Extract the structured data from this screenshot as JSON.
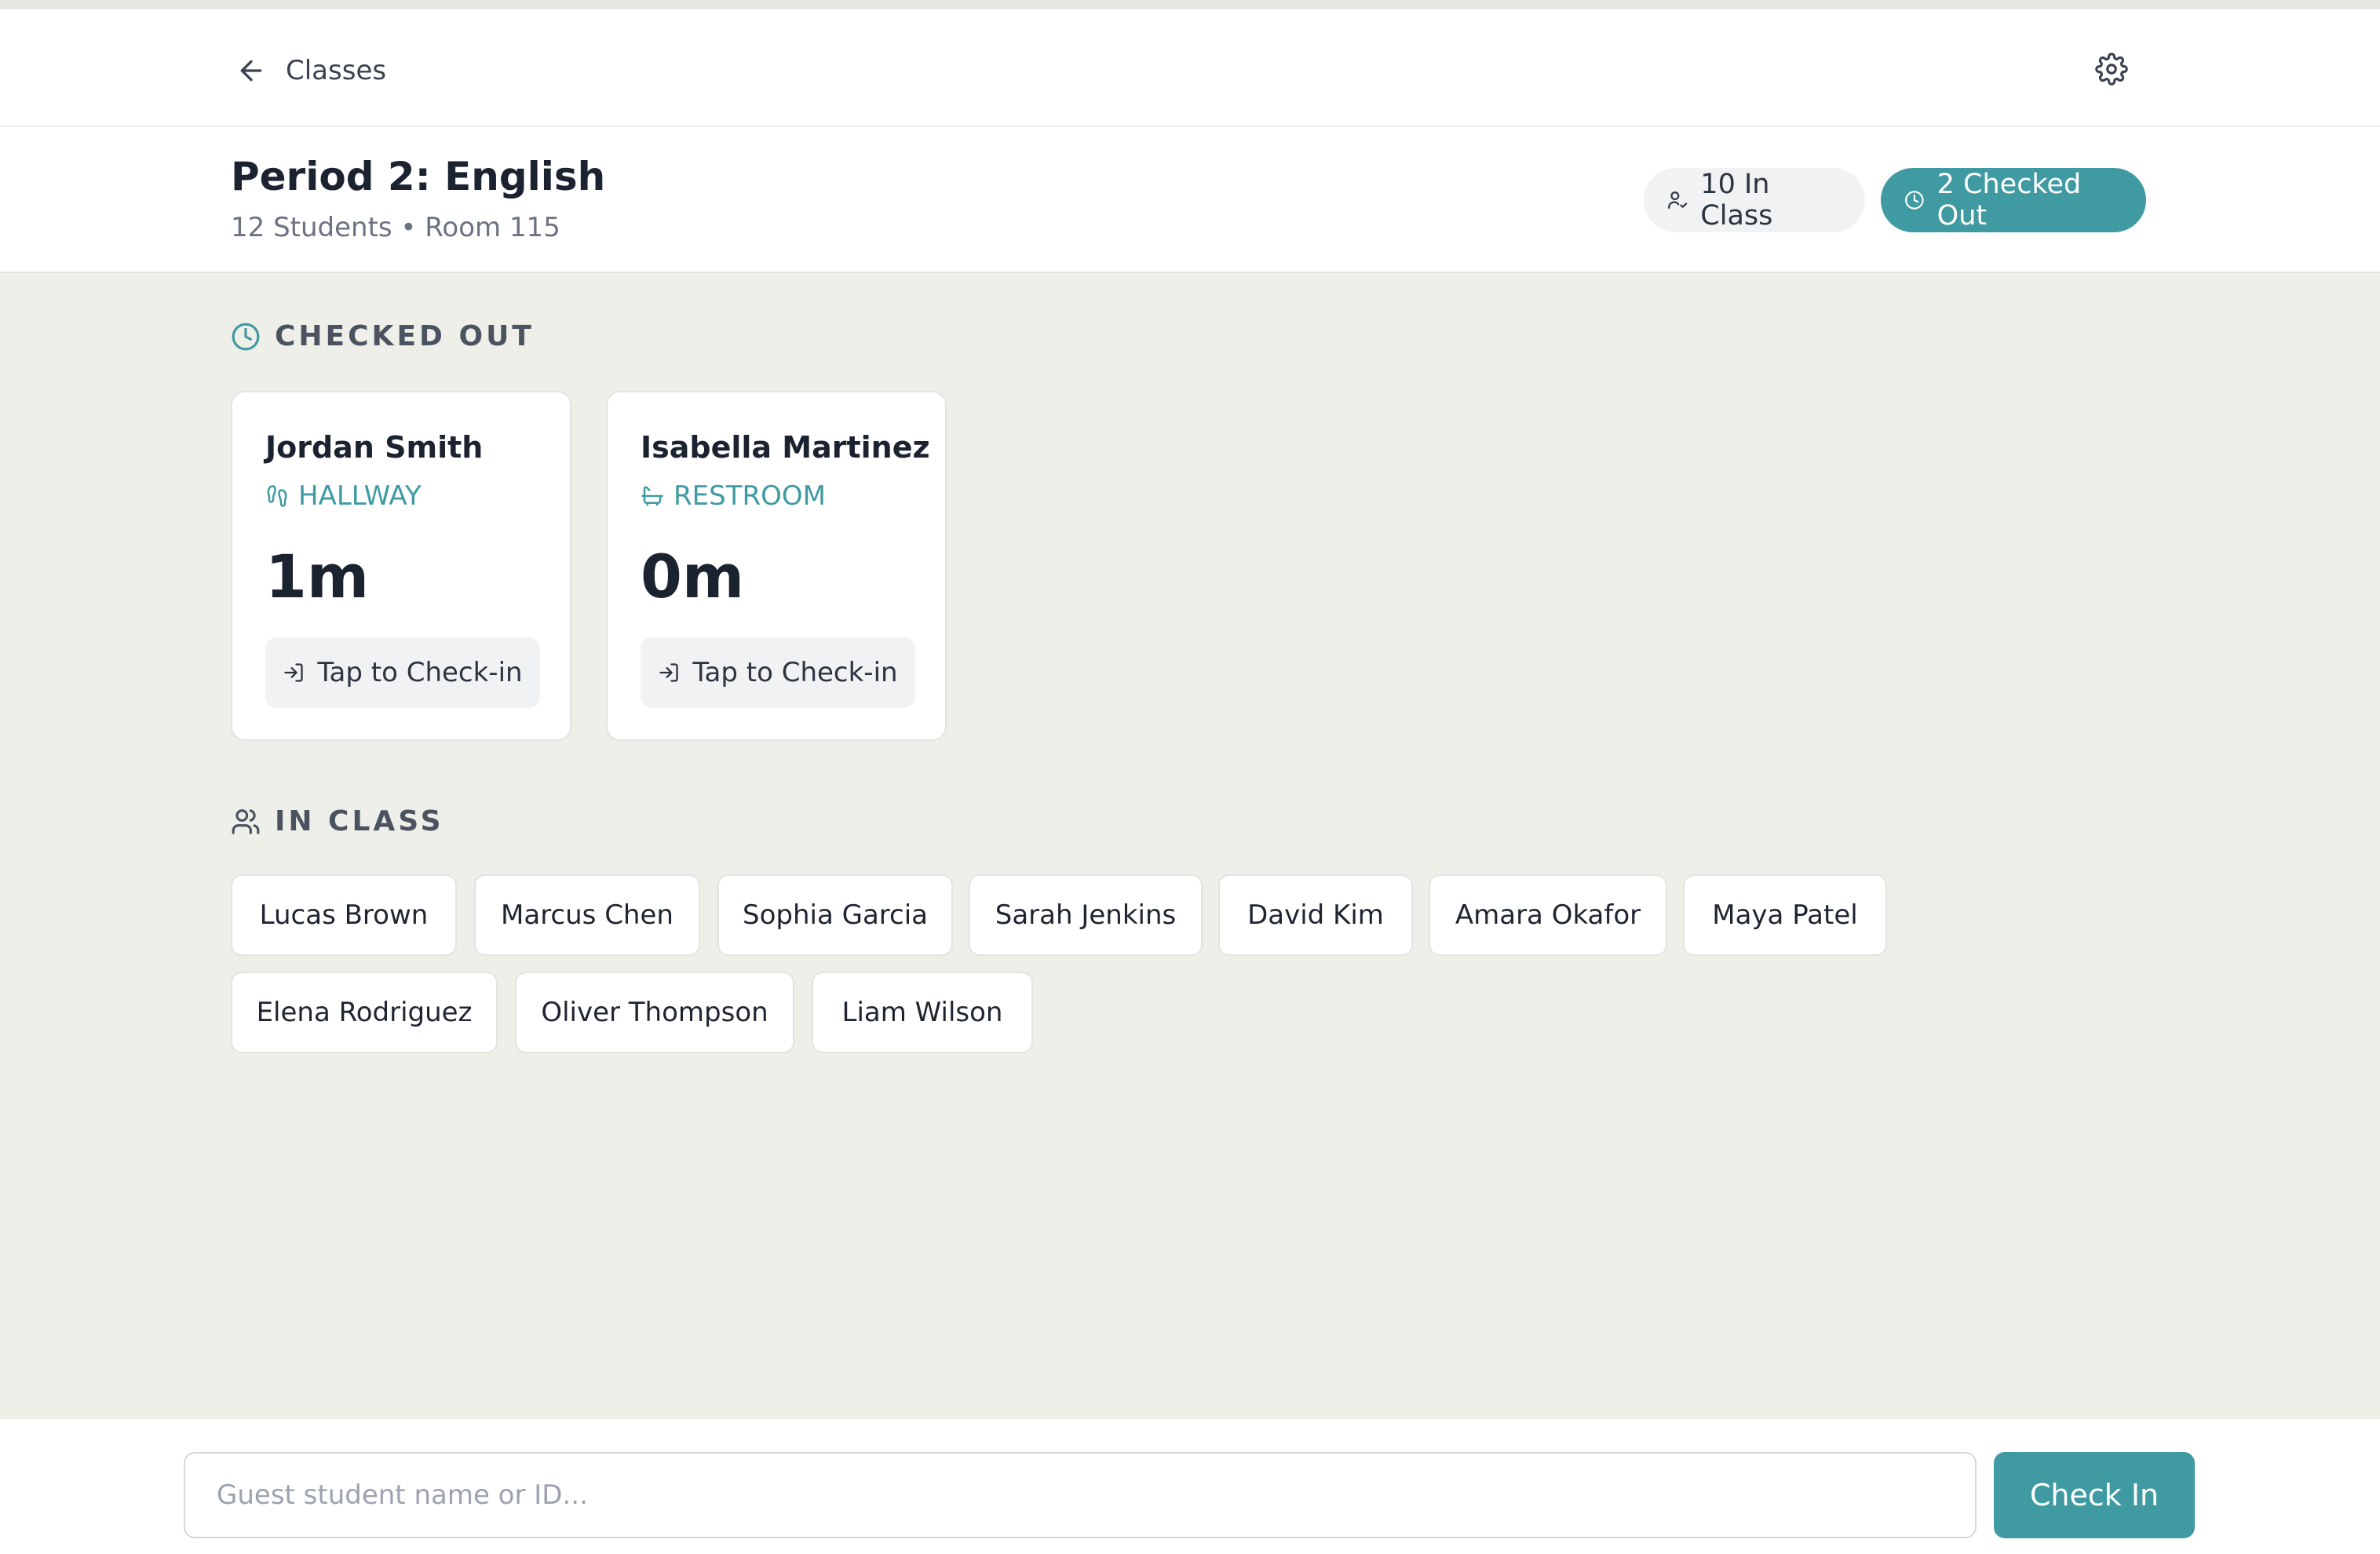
{
  "nav": {
    "back_label": "Classes"
  },
  "class_header": {
    "title": "Period 2: English",
    "subtitle": "12 Students • Room 115",
    "in_class_pill": "10 In Class",
    "checked_out_pill": "2 Checked Out"
  },
  "sections": {
    "checked_out_label": "CHECKED OUT",
    "in_class_label": "IN CLASS"
  },
  "checked_out": [
    {
      "name": "Jordan Smith",
      "location": "HALLWAY",
      "location_icon": "footprints-icon",
      "elapsed": "1m",
      "action": "Tap to Check-in"
    },
    {
      "name": "Isabella Martinez",
      "location": "RESTROOM",
      "location_icon": "bath-icon",
      "elapsed": "0m",
      "action": "Tap to Check-in"
    }
  ],
  "in_class": [
    "Lucas Brown",
    "Marcus Chen",
    "Sophia Garcia",
    "Sarah Jenkins",
    "David Kim",
    "Amara Okafor",
    "Maya Patel",
    "Elena Rodriguez",
    "Oliver Thompson",
    "Liam Wilson"
  ],
  "footer": {
    "guest_placeholder": "Guest student name or ID...",
    "checkin_button": "Check In"
  },
  "colors": {
    "accent": "#3f9aa2",
    "background": "#efefe9",
    "card": "#ffffff"
  }
}
